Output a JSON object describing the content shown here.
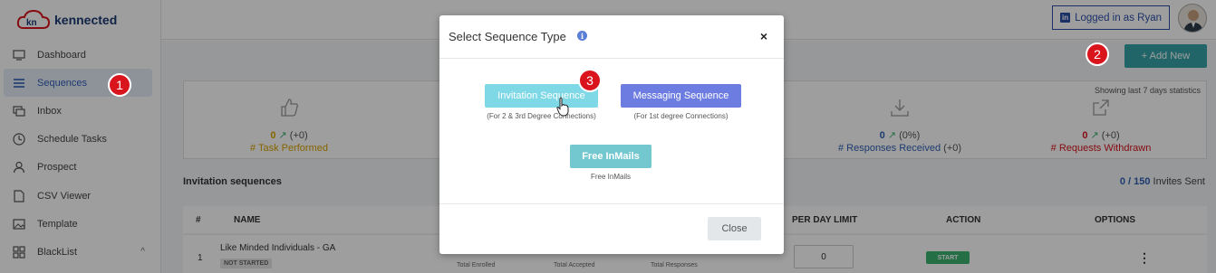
{
  "app": {
    "logo_text": "kennected",
    "logo_mark": "kn",
    "login_label": "Logged in as Ryan",
    "add_new_label": "+ Add New"
  },
  "sidebar": {
    "items": [
      {
        "label": "Dashboard",
        "icon": "monitor-icon"
      },
      {
        "label": "Sequences",
        "icon": "list-icon",
        "active": true
      },
      {
        "label": "Inbox",
        "icon": "chat-icon"
      },
      {
        "label": "Schedule Tasks",
        "icon": "clock-icon"
      },
      {
        "label": "Prospect",
        "icon": "user-icon"
      },
      {
        "label": "CSV Viewer",
        "icon": "file-icon"
      },
      {
        "label": "Template",
        "icon": "image-icon"
      },
      {
        "label": "BlackList",
        "icon": "grid-icon",
        "caret": "^"
      }
    ]
  },
  "stats": {
    "showing_label": "Showing last 7 days statistics",
    "task": {
      "value": "0",
      "delta": "(+0)",
      "label": "# Task Performed"
    },
    "responses": {
      "value": "0",
      "delta": "(0%)",
      "label": "# Responses Received",
      "extra": "(+0)"
    },
    "withdrawn": {
      "value": "0",
      "delta": "(+0)",
      "label": "# Requests Withdrawn"
    }
  },
  "invitations": {
    "title": "Invitation sequences",
    "sent_count": "0 / 150",
    "sent_label": "Invites Sent"
  },
  "table": {
    "headers": {
      "num": "#",
      "name": "NAME",
      "per_day": "PER DAY LIMIT",
      "action": "ACTION",
      "options": "OPTIONS"
    },
    "rows": [
      {
        "num": "1",
        "name": "Like Minded Individuals - GA",
        "status": "NOT STARTED",
        "enrolled": "Total Enrolled",
        "accepted": "Total Accepted",
        "responses": "Total Responses",
        "per_day": "0",
        "action": "START",
        "options": "⋮"
      }
    ]
  },
  "badges": {
    "one": "1",
    "two": "2",
    "three": "3"
  },
  "modal": {
    "title": "Select Sequence Type",
    "close_x": "×",
    "invitation_label": "Invitation Sequence",
    "invitation_note": "(For 2 & 3rd Degree Connections)",
    "messaging_label": "Messaging Sequence",
    "messaging_note": "(For 1st degree Connections)",
    "inmail_label": "Free InMails",
    "inmail_note": "Free InMails",
    "close_label": "Close"
  },
  "colors": {
    "overlay": "rgba(0,0,0,0.38)",
    "invite_btn": "#7fd8e6",
    "message_btn": "#6d7ce0",
    "inmail_btn": "#73c7cf",
    "badge_red": "#d9141c",
    "add_new": "#36a3a8"
  }
}
